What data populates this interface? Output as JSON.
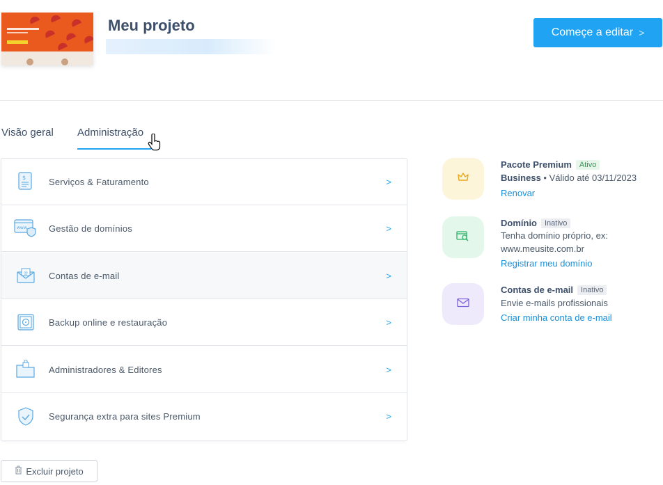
{
  "project": {
    "title": "Meu projeto",
    "edit_button": "Começe a editar",
    "edit_chevron": ">"
  },
  "tabs": [
    {
      "label": "Visão geral"
    },
    {
      "label": "Administração"
    }
  ],
  "menu": {
    "chevron": ">",
    "items": [
      {
        "label": "Serviços & Faturamento",
        "icon": "invoice-icon"
      },
      {
        "label": "Gestão de domínios",
        "icon": "www-shield-icon"
      },
      {
        "label": "Contas de e-mail",
        "icon": "email-envelope-icon"
      },
      {
        "label": "Backup online e restauração",
        "icon": "safe-icon"
      },
      {
        "label": "Administradores & Editores",
        "icon": "folder-lock-icon"
      },
      {
        "label": "Segurança extra para sites Premium",
        "icon": "shield-check-icon"
      }
    ]
  },
  "status": [
    {
      "title": "Pacote Premium",
      "badge": "Ativo",
      "plan": "Business",
      "bullet": " • ",
      "detail": "Válido até 03/11/2023",
      "link": "Renovar",
      "icon": "crown-icon",
      "color": "#fdf5da"
    },
    {
      "title": "Domínio",
      "badge": "Inativo",
      "line1": "Tenha domínio próprio, ex:",
      "line2": "www.meusite.com.br",
      "link": "Registrar meu domínio",
      "icon": "domain-search-icon",
      "color": "#e3f7ea"
    },
    {
      "title": "Contas de e-mail",
      "badge": "Inativo",
      "line1": "Envie e-mails profissionais",
      "link": "Criar minha conta de e-mail",
      "icon": "mail-icon",
      "color": "#eeeafc"
    }
  ],
  "delete_button": "Excluir projeto",
  "colors": {
    "accent": "#1fa3f2",
    "link": "#1a8fd8",
    "text": "#3d4f6a"
  }
}
